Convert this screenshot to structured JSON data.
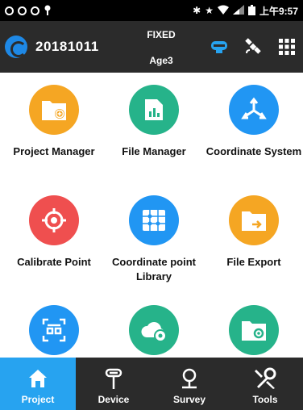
{
  "status_bar": {
    "time": "上午9:57",
    "icons": [
      "record-icon",
      "record-icon",
      "record-icon",
      "location-pin-icon",
      "bluetooth-icon",
      "star-icon",
      "wifi-icon",
      "signal-icon",
      "battery-icon"
    ]
  },
  "header": {
    "job_name": "20181011",
    "fix_status": "FIXED",
    "age": "Age3",
    "icons": [
      "gnss-receiver-icon",
      "satellite-icon",
      "menu-grid-icon"
    ]
  },
  "tiles": [
    {
      "label": "Project Manager",
      "color": "#f5a623",
      "icon": "folder-add-icon"
    },
    {
      "label": "File Manager",
      "color": "#26b38a",
      "icon": "document-chart-icon"
    },
    {
      "label": "Coordinate System",
      "color": "#2196f3",
      "icon": "axes-icon"
    },
    {
      "label": "Calibrate Point",
      "color": "#ef4f4f",
      "icon": "crosshair-icon"
    },
    {
      "label": "Coordinate point Library",
      "color": "#2196f3",
      "icon": "grid-points-icon"
    },
    {
      "label": "File Export",
      "color": "#f5a623",
      "icon": "folder-export-icon"
    },
    {
      "label": "",
      "color": "#2196f3",
      "icon": "qr-code-icon"
    },
    {
      "label": "",
      "color": "#26b38a",
      "icon": "cloud-settings-icon"
    },
    {
      "label": "",
      "color": "#26b38a",
      "icon": "folder-settings-icon"
    }
  ],
  "tabs": [
    {
      "label": "Project",
      "icon": "home-icon",
      "active": true
    },
    {
      "label": "Device",
      "icon": "receiver-icon",
      "active": false
    },
    {
      "label": "Survey",
      "icon": "map-pin-icon",
      "active": false
    },
    {
      "label": "Tools",
      "icon": "tools-icon",
      "active": false
    }
  ],
  "colors": {
    "header_bg": "#2b2b2b",
    "active_tab": "#27a3f0",
    "accent_blue": "#27a3f0"
  }
}
